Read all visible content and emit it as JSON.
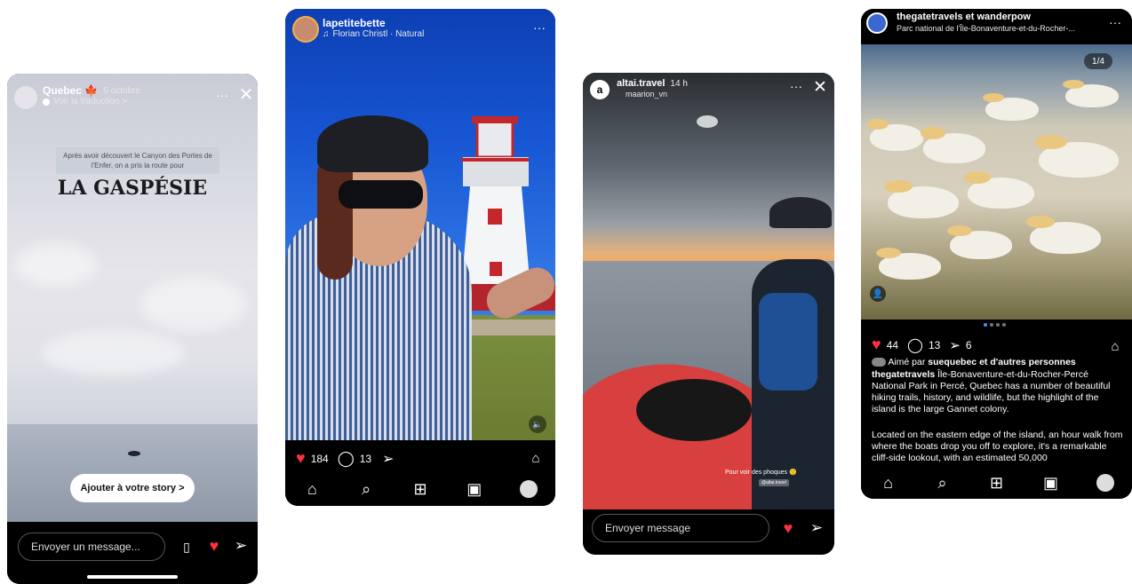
{
  "story1": {
    "account": "Quebec 🍁",
    "date": "6 octobre",
    "translate": "Voir la traduction >",
    "sticker_text": "Après avoir découvert le Canyon des Portes de l'Enfer, on a pris la route pour",
    "headline": "LA GASPÉSIE",
    "add_story_label": "Ajouter à votre story >",
    "message_placeholder": "Envoyer un message..."
  },
  "post2": {
    "account": "lapetitebette",
    "music": "Florian Christl · Natural",
    "likes": "184",
    "comments": "13"
  },
  "story3": {
    "account": "altai.travel",
    "time": "14 h",
    "mention": "maarion_vn",
    "caption": "Pour voir des phoques 🙂",
    "tag": "@altai.travel",
    "message_placeholder": "Envoyer message"
  },
  "post4": {
    "accounts": "thegatetravels et wanderpow",
    "location": "Parc national de l'Île-Bonaventure-et-du-Rocher-...",
    "counter": "1/4",
    "likes": "44",
    "comments": "13",
    "shares": "6",
    "liked_by_prefix": "Aimé par",
    "liked_by_user": "suequebec",
    "liked_by_suffix": "et d'autres personnes",
    "caption_user": "thegatetravels",
    "caption_text": "Île-Bonaventure-et-du-Rocher-Percé National Park in Percé, Quebec has a number of beautiful hiking trails, history, and wildlife, but the highlight of the island is the large Gannet colony.",
    "caption_text2": "Located on the eastern edge of the island, an hour walk from where the boats drop you off to explore, it's a remarkable cliff-side lookout, with an estimated 50,000"
  },
  "colors": {
    "like_red": "#ff3040",
    "black": "#000000",
    "white": "#ffffff"
  },
  "icons": [
    "home-icon",
    "search-icon",
    "create-icon",
    "reels-icon",
    "profile-icon",
    "heart-icon",
    "comment-icon",
    "share-icon",
    "bookmark-icon",
    "more-icon",
    "close-icon",
    "sound-icon"
  ]
}
